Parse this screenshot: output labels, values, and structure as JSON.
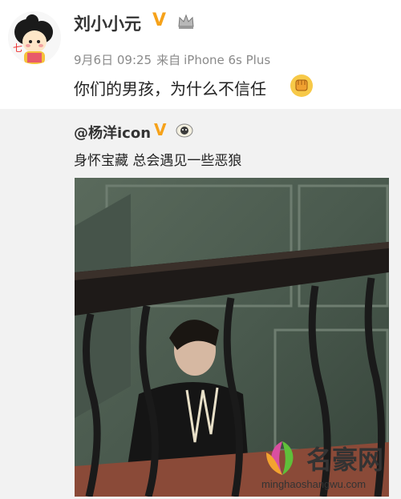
{
  "post": {
    "username": "刘小小元",
    "date": "9月6日 09:25",
    "source_prefix": "来自",
    "source": "iPhone 6s Plus",
    "content": "你们的男孩，为什么不信任",
    "icons": {
      "verified": "v-badge-icon",
      "crown": "crown-icon",
      "emoji": "fist-emoji-icon"
    }
  },
  "repost": {
    "username": "@杨洋icon",
    "content": "身怀宝藏 总会遇见一些恶狼",
    "icons": {
      "verified": "v-badge-icon",
      "sheep": "sheep-icon"
    }
  },
  "watermark": {
    "name": "名豪网",
    "url": "minghaoshangwu.com"
  },
  "colors": {
    "accent": "#f6a21a",
    "repost_bg": "#f2f2f2"
  }
}
